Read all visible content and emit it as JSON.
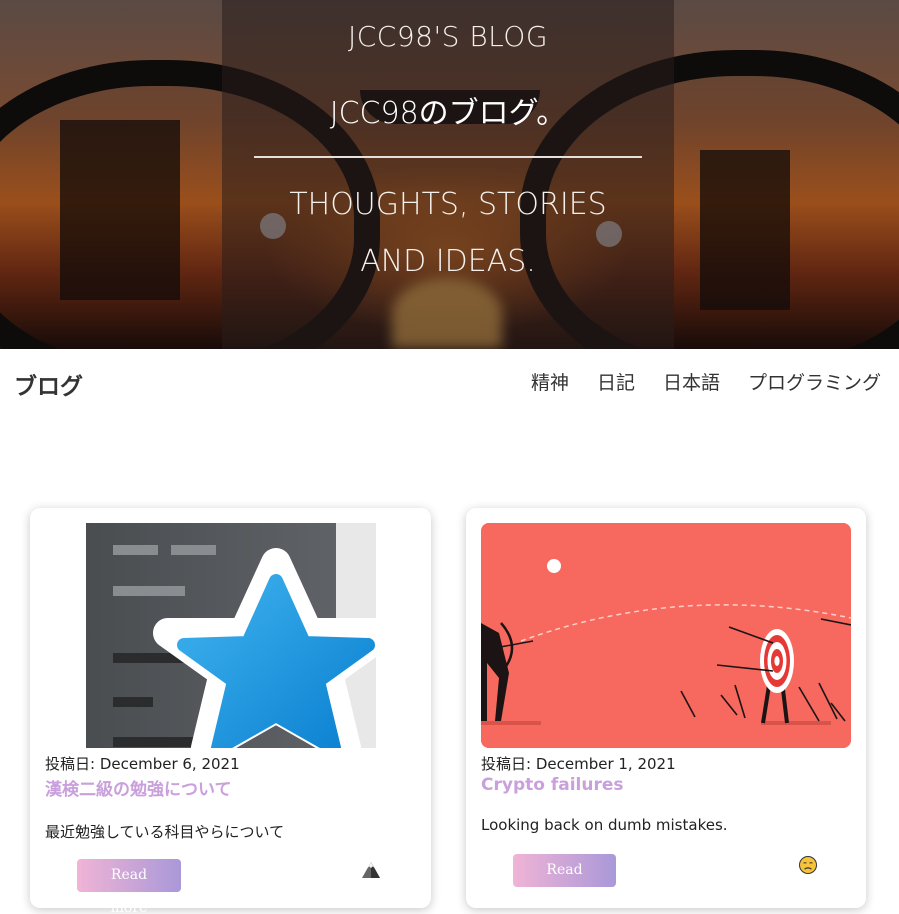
{
  "hero": {
    "blog_title": "JCC98'S BLOG",
    "jp_title_latin": "JCC98",
    "jp_title_rest": "のブログ。",
    "tagline": "THOUGHTS, STORIES AND IDEAS."
  },
  "nav": {
    "brand": "ブログ",
    "items": [
      {
        "label": "精神"
      },
      {
        "label": "日記"
      },
      {
        "label": "日本語"
      },
      {
        "label": "プログラミング"
      }
    ]
  },
  "posts": [
    {
      "meta": "投稿日: December 6, 2021",
      "title": "漢検二級の勉強について",
      "excerpt": "最近勉強している科目やらについて",
      "button": "Read more",
      "thumb_icon": "anki-star-icon",
      "emoji_icon": "mountain-icon"
    },
    {
      "meta": "投稿日: December 1, 2021",
      "title": "Crypto failures",
      "excerpt": "Looking back on dumb mistakes.",
      "button": "Read more",
      "thumb_icon": "archer-target-icon",
      "emoji_icon": "disappointed-face-icon"
    }
  ],
  "colors": {
    "title_purple": "#c9a0dc",
    "button_gradient_start": "#f0b4d6",
    "button_gradient_end": "#a998d8",
    "thumb_coral": "#f7695e"
  }
}
